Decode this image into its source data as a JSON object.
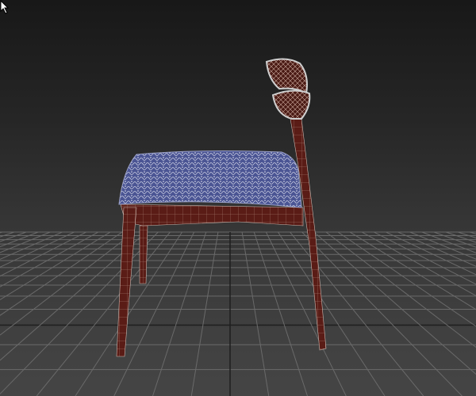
{
  "viewport": {
    "colors": {
      "grid": "#6a6a6a",
      "grid_axis": "#1e1e1e",
      "fabric": "#4b5594",
      "wood": "#5a1c16",
      "wire": "#c9b8b0"
    },
    "show_grid": true,
    "object": "chair"
  }
}
